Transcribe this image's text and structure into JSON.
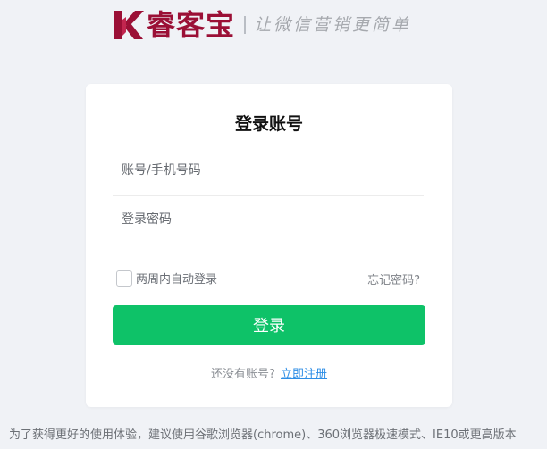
{
  "header": {
    "brand_name": "睿客宝",
    "slogan": "让微信营销更简单",
    "brand_color": "#9b1036"
  },
  "login_card": {
    "title": "登录账号",
    "account_placeholder": "账号/手机号码",
    "password_placeholder": "登录密码",
    "remember_label": "两周内自动登录",
    "remember_checked": false,
    "forgot_label": "忘记密码?",
    "login_button_label": "登录",
    "login_button_color": "#0ec268",
    "register_question": "还没有账号?",
    "register_link": "立即注册",
    "link_color": "#2e8ee6"
  },
  "footer": {
    "browser_note": "为了获得更好的使用体验，建议使用谷歌浏览器(chrome)、360浏览器极速模式、IE10或更高版本"
  },
  "icons": {
    "logo": "k-logo-icon",
    "checkbox": "checkbox-icon"
  }
}
